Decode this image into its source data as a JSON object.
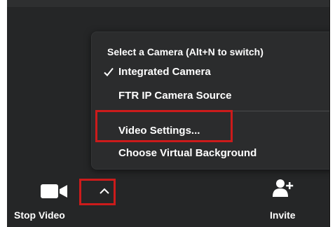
{
  "camera_menu": {
    "header": "Select a Camera (Alt+N to switch)",
    "items": [
      {
        "label": "Integrated Camera",
        "checked": true
      },
      {
        "label": "FTR IP Camera Source",
        "checked": false
      }
    ],
    "actions": [
      {
        "label": "Video Settings..."
      },
      {
        "label": "Choose Virtual Background"
      }
    ]
  },
  "toolbar": {
    "stop_video_label": "Stop Video",
    "invite_label": "Invite",
    "icons": {
      "video": "video-camera-icon",
      "caret": "chevron-up-icon",
      "invite": "add-user-icon"
    }
  },
  "colors": {
    "background": "#252627",
    "menu_bg": "#2b2c2d",
    "text": "#ffffff",
    "highlight": "#cc1b1b"
  }
}
